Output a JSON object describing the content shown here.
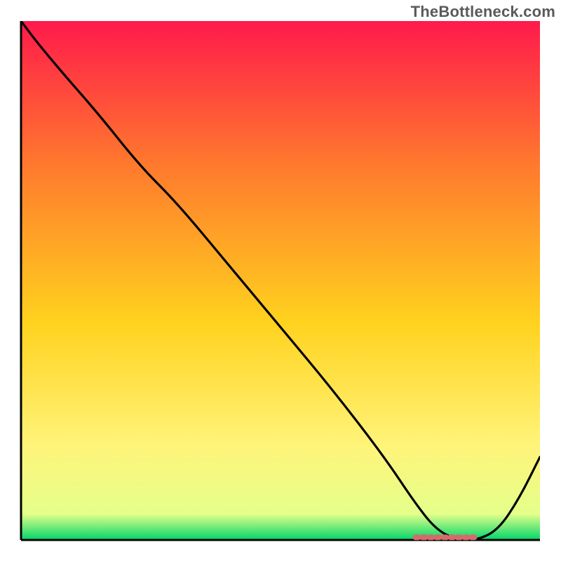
{
  "watermark": "TheBottleneck.com",
  "chart_data": {
    "type": "line",
    "title": "",
    "xlabel": "",
    "ylabel": "",
    "xlim": [
      0,
      100
    ],
    "ylim": [
      0,
      100
    ],
    "grid": false,
    "legend": false,
    "x": [
      0,
      3,
      8,
      15,
      23,
      30,
      40,
      50,
      60,
      70,
      76,
      80,
      84,
      88,
      92,
      96,
      100
    ],
    "y": [
      100,
      96,
      90,
      82,
      72,
      65,
      53,
      41,
      29,
      16,
      7,
      2,
      0,
      0,
      2,
      8,
      16
    ],
    "optimal_marker_x_range": [
      76,
      88
    ],
    "colors": {
      "gradient_top": "#ff1a4b",
      "gradient_mid1": "#ff7a2d",
      "gradient_mid2": "#ffd21e",
      "gradient_mid3": "#fff47a",
      "gradient_bottom": "#00d66b",
      "curve": "#000000",
      "axis": "#000000",
      "marker": "#d46a6a"
    }
  }
}
